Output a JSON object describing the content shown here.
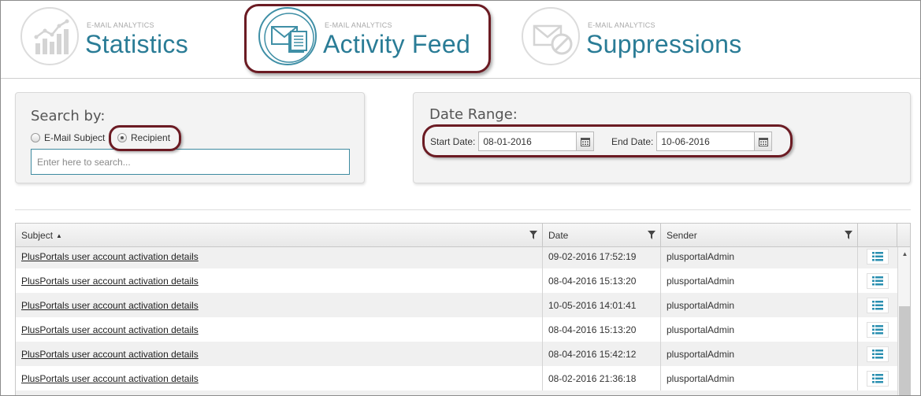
{
  "tabs": [
    {
      "small": "E-MAIL ANALYTICS",
      "label": "Statistics",
      "icon": "bar-chart-icon",
      "active": false
    },
    {
      "small": "E-MAIL ANALYTICS",
      "label": "Activity Feed",
      "icon": "envelope-document-icon",
      "active": true
    },
    {
      "small": "E-MAIL ANALYTICS",
      "label": "Suppressions",
      "icon": "envelope-blocked-icon",
      "active": false
    }
  ],
  "search": {
    "title": "Search by:",
    "options": [
      "E-Mail Subject",
      "Recipient"
    ],
    "selected": "Recipient",
    "placeholder": "Enter here to search..."
  },
  "date_range": {
    "title": "Date Range:",
    "start_label": "Start Date:",
    "start_value": "08-01-2016",
    "end_label": "End Date:",
    "end_value": "10-06-2016"
  },
  "grid": {
    "columns": [
      "Subject",
      "Date",
      "Sender"
    ],
    "sort_column": "Subject",
    "sort_dir": "asc",
    "rows": [
      {
        "subject": "PlusPortals user account activation details",
        "date": "09-02-2016 17:52:19",
        "sender": "plusportalAdmin"
      },
      {
        "subject": "PlusPortals user account activation details",
        "date": "08-04-2016 15:13:20",
        "sender": "plusportalAdmin"
      },
      {
        "subject": "PlusPortals user account activation details",
        "date": "10-05-2016 14:01:41",
        "sender": "plusportalAdmin"
      },
      {
        "subject": "PlusPortals user account activation details",
        "date": "08-04-2016 15:13:20",
        "sender": "plusportalAdmin"
      },
      {
        "subject": "PlusPortals user account activation details",
        "date": "08-04-2016 15:42:12",
        "sender": "plusportalAdmin"
      },
      {
        "subject": "PlusPortals user account activation details",
        "date": "08-02-2016 21:36:18",
        "sender": "plusportalAdmin"
      }
    ]
  },
  "colors": {
    "accent": "#2a7c96",
    "highlight": "#6b1b23",
    "action_icon": "#2a8fb0"
  }
}
